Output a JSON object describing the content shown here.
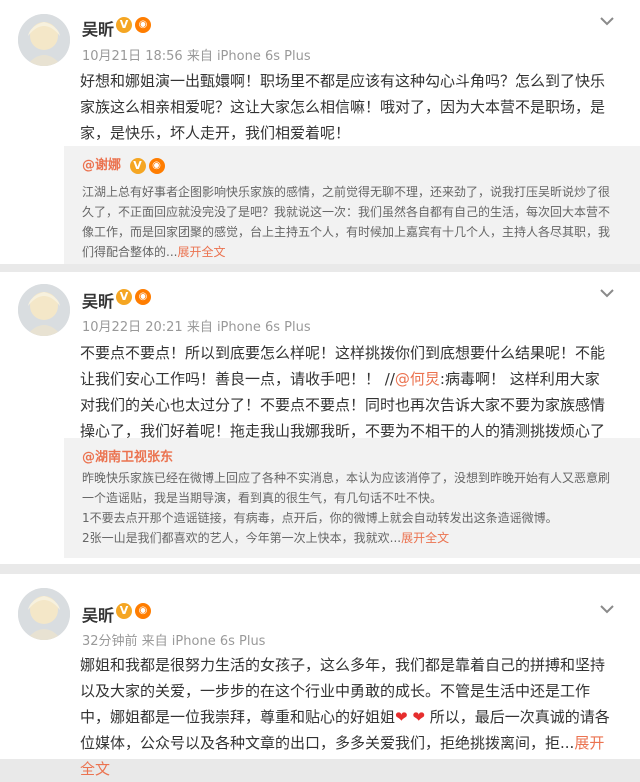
{
  "posts": [
    {
      "author": "吴昕",
      "meta": "10月21日 18:56 来自 iPhone 6s Plus",
      "text": "好想和娜姐演一出甄嬛啊！职场里不都是应该有这种勾心斗角吗？怎么到了快乐家族这么相亲相爱呢？这让大家怎么相信嘛！哦对了，因为大本营不是职场，是家，是快乐，坏人走开，我们相爱着呢！",
      "quote": {
        "author": "@谢娜",
        "text": "江湖上总有好事者企图影响快乐家族的感情，之前觉得无聊不理，还来劲了，说我打压吴昕说炒了很久了，不正面回应就没完没了是吧？我就说这一次：我们虽然各自都有自己的生活，每次回大本营不像工作，而是回家团聚的感觉，台上主持五个人，有时候加上嘉宾有十几个人，主持人各尽其职，我们得配合整体的...",
        "more": "展开全文"
      }
    },
    {
      "author": "吴昕",
      "meta": "10月22日 20:21 来自 iPhone 6s Plus",
      "text_a": "不要点不要点！所以到底要怎么样呢！这样挑拨你们到底想要什么结果呢！不能让我们安心工作吗！善良一点，请收手吧！！ //",
      "mention": "@何炅",
      "text_b": ":病毒啊！ 这样利用大家对我们的关心也太过分了！不要点不要点！同时也再次告诉大家不要为家族感情操心了，我们好着呢！拖走我山我娜我昕，不要为不相干的人的猜测挑拨烦心了",
      "quote": {
        "author": "@湖南卫视张东",
        "text_1": "昨晚快乐家族已经在微博上回应了各种不实消息，本认为应该消停了，没想到昨晚开始有人又恶意刷一个造谣贴，我是当期导演，看到真的很生气，有几句话不吐不快。",
        "text_2": "1不要去点开那个造谣链接，有病毒，点开后，你的微博上就会自动转发出这条造谣微博。",
        "text_3": "2张一山是我们都喜欢的艺人，今年第一次上快本，我就欢...",
        "more": "展开全文"
      }
    },
    {
      "author": "吴昕",
      "meta": "32分钟前 来自 iPhone 6s Plus",
      "text_a": "娜姐和我都是很努力生活的女孩子，这么多年，我们都是靠着自己的拼搏和坚持以及大家的关爱，一步步的在这个行业中勇敢的成长。不管是生活中还是工作中，娜姐都是一位我崇拜，尊重和贴心的好姐姐",
      "hearts": "❤ ❤",
      "text_b": " 所以，最后一次真诚的请各位媒体，公众号以及各种文章的出口，多多关爱我们，拒绝挑拨离间，拒...",
      "more": "展开全文"
    }
  ],
  "badge": {
    "v": "V",
    "medal": "◉"
  },
  "colors": {
    "accent": "#eb7350",
    "v_badge": "#f5a623",
    "background": "#e9e9e9"
  }
}
